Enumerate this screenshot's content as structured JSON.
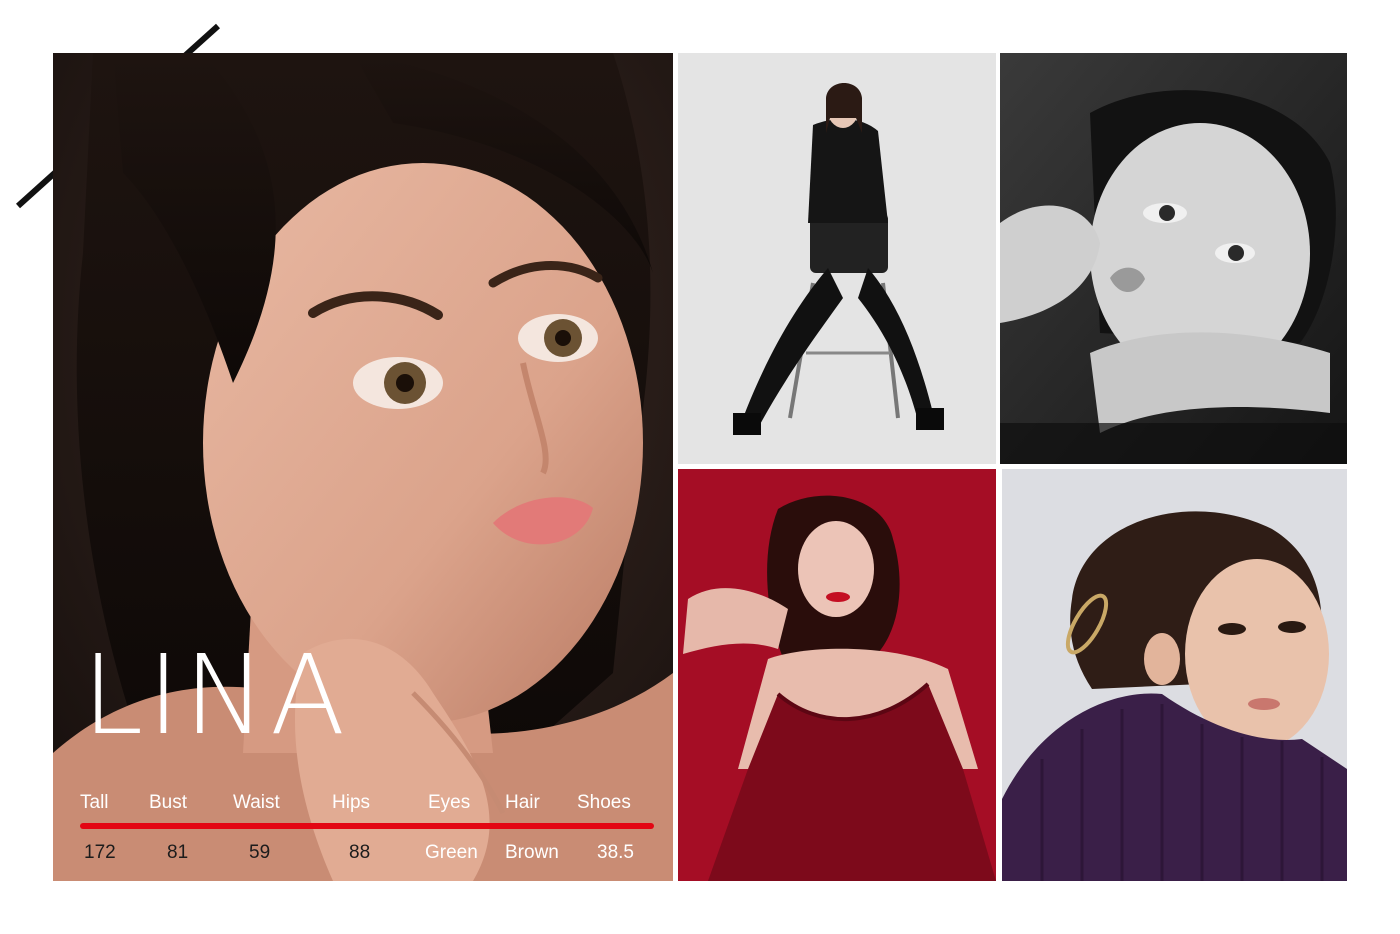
{
  "model": {
    "name": "LINA"
  },
  "stats": {
    "headers": [
      "Tall",
      "Bust",
      "Waist",
      "Hips",
      "Eyes",
      "Hair",
      "Shoes"
    ],
    "values": [
      "172",
      "81",
      "59",
      "88",
      "Green",
      "Brown",
      "38.5"
    ]
  },
  "colors": {
    "accent": "#e30613",
    "name_text": "#ffffff",
    "background": "#ffffff"
  }
}
